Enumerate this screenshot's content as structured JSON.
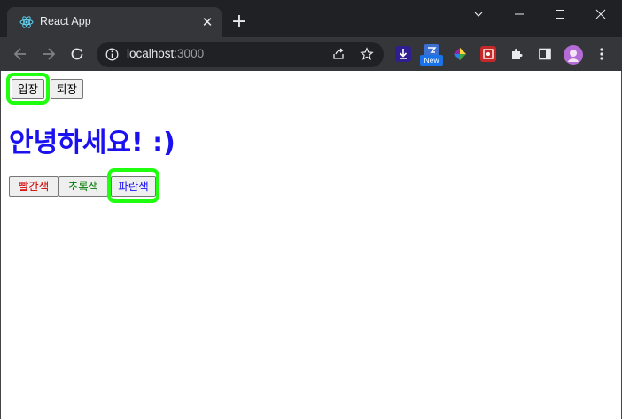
{
  "browser": {
    "tab_title": "React App",
    "tab_close": "✕",
    "new_tab": "+",
    "url_host": "localhost",
    "url_port": ":3000",
    "extension_badge": "New"
  },
  "page": {
    "enter_button": "입장",
    "exit_button": "퇴장",
    "greeting": "안녕하세요! :)",
    "red_button": "빨간색",
    "green_button": "초록색",
    "blue_button": "파란색",
    "colors": {
      "greeting": "#1a10f0",
      "red": "#d00000",
      "green": "#007a00",
      "blue": "#1a10f0",
      "highlight": "#21ff10"
    }
  },
  "icons": [
    "react-icon",
    "back-icon",
    "forward-icon",
    "reload-icon",
    "info-icon",
    "share-icon",
    "star-icon",
    "download-ext-icon",
    "new-ext-icon",
    "color-ext-icon",
    "puzzle-ext-icon",
    "extensions-icon",
    "sidepanel-icon",
    "profile-avatar",
    "menu-icon",
    "minimize-icon",
    "maximize-icon",
    "close-window-icon",
    "tab-search-icon"
  ]
}
